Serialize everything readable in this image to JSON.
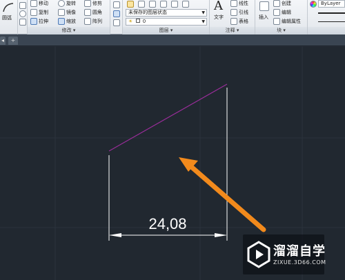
{
  "ribbon": {
    "draw": {
      "title_label": "圆弧"
    },
    "modify": {
      "title": "修改",
      "buttons": [
        "移动",
        "旋转",
        "修剪",
        "复制",
        "镜像",
        "圆角",
        "拉伸",
        "缩放",
        "阵列"
      ]
    },
    "layers": {
      "title": "图层",
      "layer_state": "未保存的图层状态",
      "current_layer": "0"
    },
    "annotation": {
      "title": "注释",
      "text_label": "文字",
      "buttons": [
        "线性",
        "引线",
        "表格"
      ]
    },
    "block": {
      "title": "块",
      "insert_label": "插入",
      "buttons": [
        "创建",
        "编辑",
        "编辑属性"
      ]
    },
    "properties": {
      "color_value": "ByLayer"
    }
  },
  "canvas": {
    "dimension_text": "24,08",
    "line_color": "#9a2d9a",
    "dimension_color": "#ffffff",
    "arrow_color": "#f28a1c",
    "background": "#212830"
  },
  "watermark": {
    "title": "溜溜自学",
    "url": "ZIXUE.3D66.COM"
  }
}
